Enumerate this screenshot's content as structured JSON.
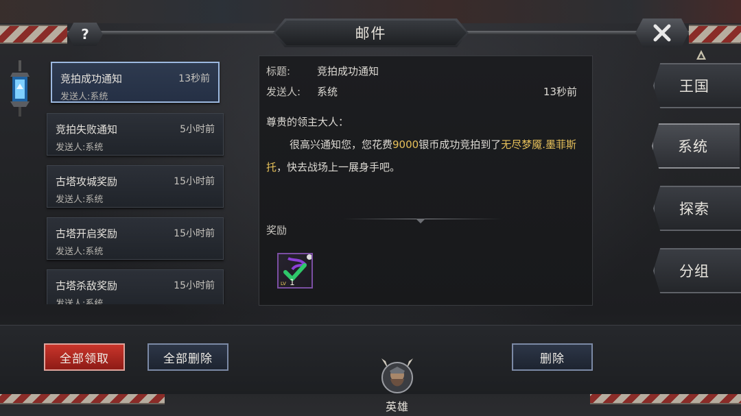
{
  "header": {
    "title": "邮件",
    "help_label": "?"
  },
  "mail_list": [
    {
      "subject": "竞拍成功通知",
      "sender": "发送人:系统",
      "time": "13秒前",
      "selected": true
    },
    {
      "subject": "竞拍失败通知",
      "sender": "发送人:系统",
      "time": "5小时前",
      "selected": false
    },
    {
      "subject": "古塔攻城奖励",
      "sender": "发送人:系统",
      "time": "15小时前",
      "selected": false
    },
    {
      "subject": "古塔开启奖励",
      "sender": "发送人:系统",
      "time": "15小时前",
      "selected": false
    },
    {
      "subject": "古塔杀敌奖励",
      "sender": "发送人:系统",
      "time": "15小时前",
      "selected": false
    }
  ],
  "detail": {
    "title_label": "标题:",
    "title_value": "竞拍成功通知",
    "sender_label": "发送人:",
    "sender_value": "系统",
    "time": "13秒前",
    "greeting": "尊贵的领主大人：",
    "body_part1": "很高兴通知您，您花费",
    "body_amount": "9000",
    "body_part2": "银币成功竞拍到了",
    "body_item": "无尽梦魇.墨菲斯托",
    "body_part3": "，快去战场上一展身手吧。",
    "reward_label": "奖励",
    "reward_level": "1"
  },
  "tabs": [
    {
      "label": "王国",
      "active": false
    },
    {
      "label": "系统",
      "active": true
    },
    {
      "label": "探索",
      "active": false
    },
    {
      "label": "分组",
      "active": false
    }
  ],
  "buttons": {
    "claim_all": "全部领取",
    "delete_all": "全部删除",
    "delete": "删除"
  },
  "hero_label": "英雄",
  "colors": {
    "highlight": "#e7c15a",
    "claim_button": "#c9352b",
    "selected_border": "#9db9e0",
    "reward_border": "#7b4fa3"
  }
}
